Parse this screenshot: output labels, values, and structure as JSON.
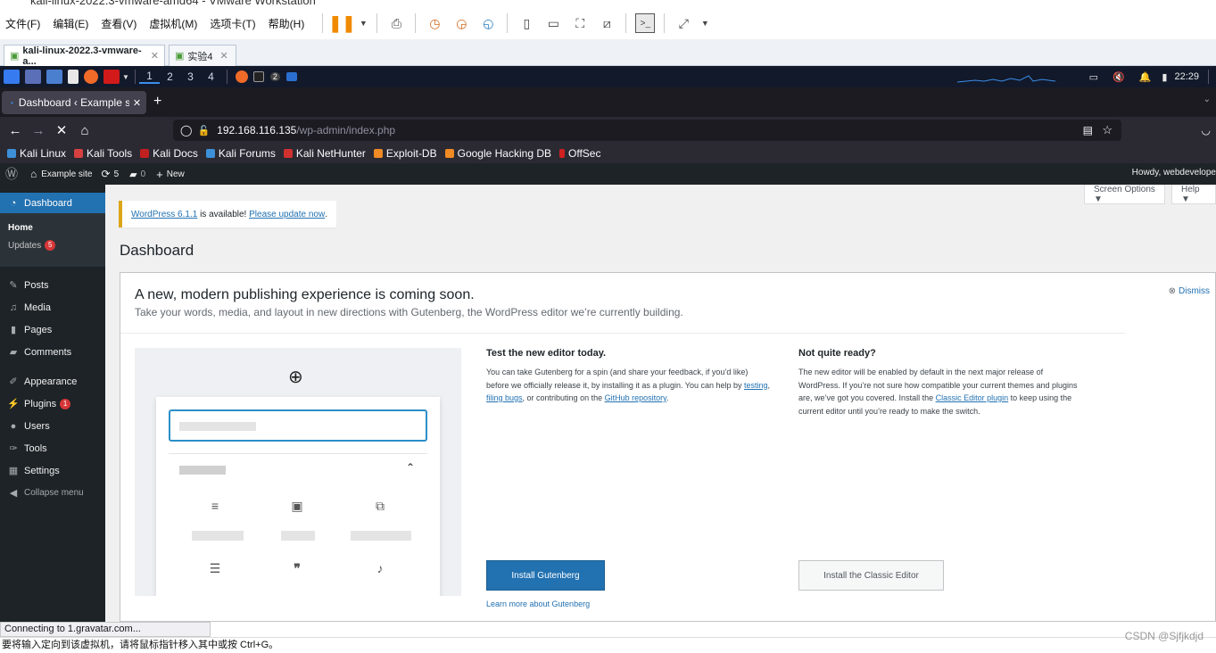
{
  "vmware": {
    "title": "kali-linux-2022.3-vmware-amd64 - VMware Workstation",
    "menu": [
      "文件(F)",
      "编辑(E)",
      "查看(V)",
      "虚拟机(M)",
      "选项卡(T)",
      "帮助(H)"
    ],
    "tabs": [
      {
        "label": "kali-linux-2022.3-vmware-a..."
      },
      {
        "label": "实验4"
      }
    ],
    "status_text": "要将输入定向到该虚拟机，请将鼠标指针移入其中或按 Ctrl+G。",
    "watermark": "CSDN @Sjfjkdjd"
  },
  "kali_panel": {
    "workspaces": [
      "1",
      "2",
      "3",
      "4"
    ],
    "clock": "22:29",
    "badge": "2"
  },
  "firefox": {
    "tab_label": "Dashboard ‹ Example site",
    "url_host": "192.168.116.135",
    "url_path": "/wp-admin/index.php",
    "bookmarks": [
      {
        "label": "Kali Linux",
        "color": "#3d8fd8"
      },
      {
        "label": "Kali Tools",
        "color": "#d64040"
      },
      {
        "label": "Kali Docs",
        "color": "#c02020"
      },
      {
        "label": "Kali Forums",
        "color": "#3d8fd8"
      },
      {
        "label": "Kali NetHunter",
        "color": "#d03030"
      },
      {
        "label": "Exploit-DB",
        "color": "#f08a24"
      },
      {
        "label": "Google Hacking DB",
        "color": "#f08a24"
      },
      {
        "label": "OffSec",
        "color": "#d02020"
      }
    ],
    "status": "Connecting to 1.gravatar.com..."
  },
  "wp_adminbar": {
    "site": "Example site",
    "updates_count": "5",
    "comments_count": "0",
    "new_label": "New",
    "howdy": "Howdy, webdevelope"
  },
  "wp_sidebar": {
    "dashboard": "Dashboard",
    "home": "Home",
    "updates": "Updates",
    "updates_count": "5",
    "items": [
      {
        "label": "Posts",
        "icon": "pin-icon"
      },
      {
        "label": "Media",
        "icon": "media-icon"
      },
      {
        "label": "Pages",
        "icon": "page-icon"
      },
      {
        "label": "Comments",
        "icon": "comment-icon"
      },
      {
        "label": "Appearance",
        "icon": "brush-icon"
      },
      {
        "label": "Plugins",
        "icon": "plugin-icon",
        "count": "1"
      },
      {
        "label": "Users",
        "icon": "user-icon"
      },
      {
        "label": "Tools",
        "icon": "wrench-icon"
      },
      {
        "label": "Settings",
        "icon": "settings-icon"
      },
      {
        "label": "Collapse menu",
        "icon": "collapse-icon"
      }
    ]
  },
  "wp_main": {
    "screen_options": "Screen Options ▼",
    "help": "Help ▼",
    "nag_version_link": "WordPress 6.1.1",
    "nag_text": " is available! ",
    "nag_update_link": "Please update now",
    "page_title": "Dashboard",
    "try_title": "A new, modern publishing experience is coming soon.",
    "try_sub": "Take your words, media, and layout in new directions with Gutenberg, the WordPress editor we’re currently building.",
    "dismiss": "Dismiss",
    "col1": {
      "heading": "Test the new editor today.",
      "text_a": "You can take Gutenberg for a spin (and share your feedback, if you’d like) before we officially release it, by installing it as a plugin. You can help by ",
      "link_testing": "testing",
      "text_b": ", ",
      "link_bugs": "filing bugs",
      "text_c": ", or contributing on the ",
      "link_github": "GitHub repository",
      "text_d": ".",
      "button": "Install Gutenberg",
      "learn_more": "Learn more about Gutenberg"
    },
    "col2": {
      "heading": "Not quite ready?",
      "text_a": "The new editor will be enabled by default in the next major release of WordPress. If you’re not sure how compatible your current themes and plugins are, we’ve got you covered. Install the ",
      "link_classic": "Classic Editor plugin",
      "text_b": " to keep using the current editor until you’re ready to make the switch.",
      "button": "Install the Classic Editor"
    }
  }
}
